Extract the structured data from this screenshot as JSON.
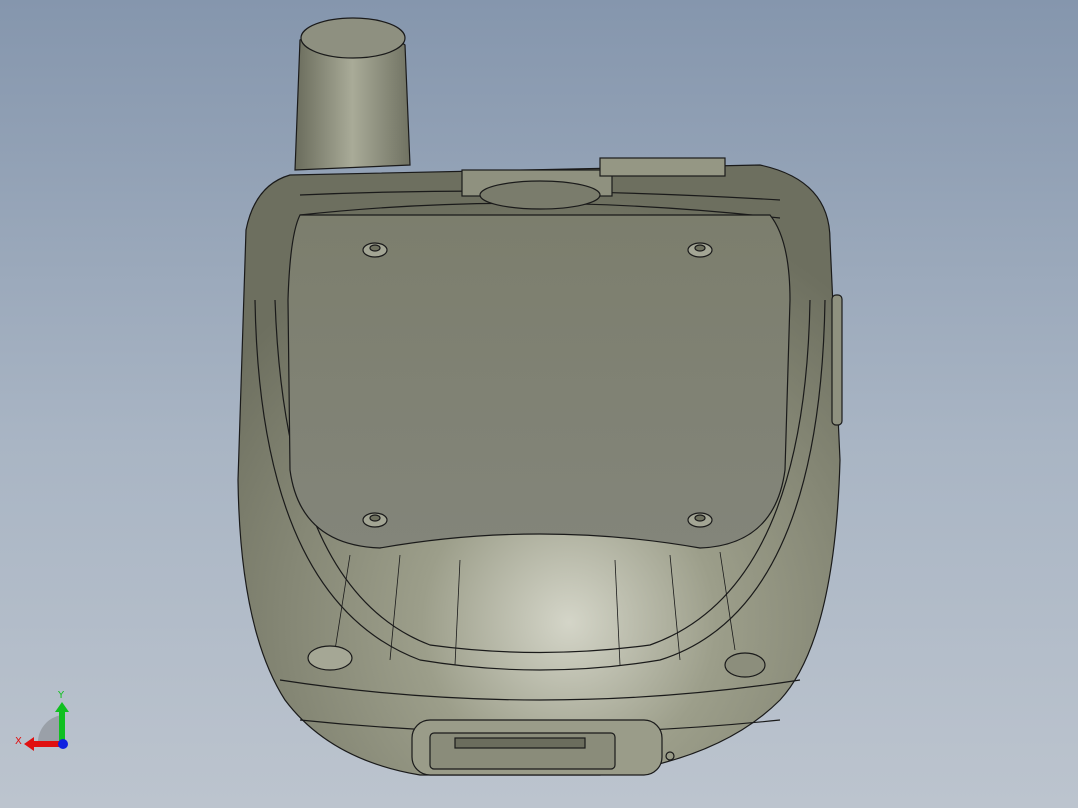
{
  "viewport": {
    "model": "handheld-radio-back-view",
    "colors": {
      "body": "#8a8c78",
      "face": "#7f8170",
      "edge": "#1a1a1a",
      "highlight": "#d9dad0"
    }
  },
  "triad": {
    "x_label": "X",
    "y_label": "Y",
    "x_color": "#e01010",
    "y_color": "#10c020",
    "z_color": "#1020e0"
  }
}
